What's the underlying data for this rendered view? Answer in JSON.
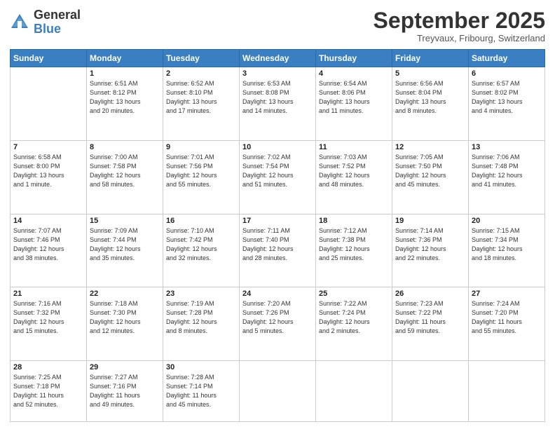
{
  "logo": {
    "general": "General",
    "blue": "Blue"
  },
  "header": {
    "month": "September 2025",
    "location": "Treyvaux, Fribourg, Switzerland"
  },
  "weekdays": [
    "Sunday",
    "Monday",
    "Tuesday",
    "Wednesday",
    "Thursday",
    "Friday",
    "Saturday"
  ],
  "weeks": [
    [
      {
        "day": "",
        "info": ""
      },
      {
        "day": "1",
        "info": "Sunrise: 6:51 AM\nSunset: 8:12 PM\nDaylight: 13 hours\nand 20 minutes."
      },
      {
        "day": "2",
        "info": "Sunrise: 6:52 AM\nSunset: 8:10 PM\nDaylight: 13 hours\nand 17 minutes."
      },
      {
        "day": "3",
        "info": "Sunrise: 6:53 AM\nSunset: 8:08 PM\nDaylight: 13 hours\nand 14 minutes."
      },
      {
        "day": "4",
        "info": "Sunrise: 6:54 AM\nSunset: 8:06 PM\nDaylight: 13 hours\nand 11 minutes."
      },
      {
        "day": "5",
        "info": "Sunrise: 6:56 AM\nSunset: 8:04 PM\nDaylight: 13 hours\nand 8 minutes."
      },
      {
        "day": "6",
        "info": "Sunrise: 6:57 AM\nSunset: 8:02 PM\nDaylight: 13 hours\nand 4 minutes."
      }
    ],
    [
      {
        "day": "7",
        "info": "Sunrise: 6:58 AM\nSunset: 8:00 PM\nDaylight: 13 hours\nand 1 minute."
      },
      {
        "day": "8",
        "info": "Sunrise: 7:00 AM\nSunset: 7:58 PM\nDaylight: 12 hours\nand 58 minutes."
      },
      {
        "day": "9",
        "info": "Sunrise: 7:01 AM\nSunset: 7:56 PM\nDaylight: 12 hours\nand 55 minutes."
      },
      {
        "day": "10",
        "info": "Sunrise: 7:02 AM\nSunset: 7:54 PM\nDaylight: 12 hours\nand 51 minutes."
      },
      {
        "day": "11",
        "info": "Sunrise: 7:03 AM\nSunset: 7:52 PM\nDaylight: 12 hours\nand 48 minutes."
      },
      {
        "day": "12",
        "info": "Sunrise: 7:05 AM\nSunset: 7:50 PM\nDaylight: 12 hours\nand 45 minutes."
      },
      {
        "day": "13",
        "info": "Sunrise: 7:06 AM\nSunset: 7:48 PM\nDaylight: 12 hours\nand 41 minutes."
      }
    ],
    [
      {
        "day": "14",
        "info": "Sunrise: 7:07 AM\nSunset: 7:46 PM\nDaylight: 12 hours\nand 38 minutes."
      },
      {
        "day": "15",
        "info": "Sunrise: 7:09 AM\nSunset: 7:44 PM\nDaylight: 12 hours\nand 35 minutes."
      },
      {
        "day": "16",
        "info": "Sunrise: 7:10 AM\nSunset: 7:42 PM\nDaylight: 12 hours\nand 32 minutes."
      },
      {
        "day": "17",
        "info": "Sunrise: 7:11 AM\nSunset: 7:40 PM\nDaylight: 12 hours\nand 28 minutes."
      },
      {
        "day": "18",
        "info": "Sunrise: 7:12 AM\nSunset: 7:38 PM\nDaylight: 12 hours\nand 25 minutes."
      },
      {
        "day": "19",
        "info": "Sunrise: 7:14 AM\nSunset: 7:36 PM\nDaylight: 12 hours\nand 22 minutes."
      },
      {
        "day": "20",
        "info": "Sunrise: 7:15 AM\nSunset: 7:34 PM\nDaylight: 12 hours\nand 18 minutes."
      }
    ],
    [
      {
        "day": "21",
        "info": "Sunrise: 7:16 AM\nSunset: 7:32 PM\nDaylight: 12 hours\nand 15 minutes."
      },
      {
        "day": "22",
        "info": "Sunrise: 7:18 AM\nSunset: 7:30 PM\nDaylight: 12 hours\nand 12 minutes."
      },
      {
        "day": "23",
        "info": "Sunrise: 7:19 AM\nSunset: 7:28 PM\nDaylight: 12 hours\nand 8 minutes."
      },
      {
        "day": "24",
        "info": "Sunrise: 7:20 AM\nSunset: 7:26 PM\nDaylight: 12 hours\nand 5 minutes."
      },
      {
        "day": "25",
        "info": "Sunrise: 7:22 AM\nSunset: 7:24 PM\nDaylight: 12 hours\nand 2 minutes."
      },
      {
        "day": "26",
        "info": "Sunrise: 7:23 AM\nSunset: 7:22 PM\nDaylight: 11 hours\nand 59 minutes."
      },
      {
        "day": "27",
        "info": "Sunrise: 7:24 AM\nSunset: 7:20 PM\nDaylight: 11 hours\nand 55 minutes."
      }
    ],
    [
      {
        "day": "28",
        "info": "Sunrise: 7:25 AM\nSunset: 7:18 PM\nDaylight: 11 hours\nand 52 minutes."
      },
      {
        "day": "29",
        "info": "Sunrise: 7:27 AM\nSunset: 7:16 PM\nDaylight: 11 hours\nand 49 minutes."
      },
      {
        "day": "30",
        "info": "Sunrise: 7:28 AM\nSunset: 7:14 PM\nDaylight: 11 hours\nand 45 minutes."
      },
      {
        "day": "",
        "info": ""
      },
      {
        "day": "",
        "info": ""
      },
      {
        "day": "",
        "info": ""
      },
      {
        "day": "",
        "info": ""
      }
    ]
  ]
}
